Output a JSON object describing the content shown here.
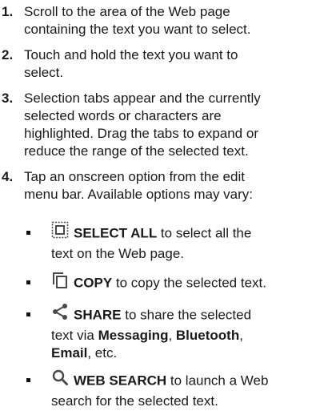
{
  "steps": [
    {
      "num": "1.",
      "lines": [
        "Scroll to the area of the Web page",
        "containing the text you want to select."
      ]
    },
    {
      "num": "2.",
      "lines": [
        "Touch and hold the text you want to",
        "select."
      ]
    },
    {
      "num": "3.",
      "lines": [
        "Selection tabs appear and the currently",
        "selected words or characters are",
        "highlighted. Drag the tabs to expand or",
        "reduce the range of the selected text."
      ]
    },
    {
      "num": "4.",
      "lines": [
        "Tap an onscreen option from the edit",
        "menu bar. Available options may vary:"
      ]
    }
  ],
  "options": [
    {
      "icon": "select-all-icon",
      "label": "SELECT ALL",
      "line1_rest": " to select all the",
      "line2": "text on the Web page."
    },
    {
      "icon": "copy-icon",
      "label": "COPY",
      "line1_rest": " to copy the selected text."
    },
    {
      "icon": "share-icon",
      "label": "SHARE",
      "line1_rest": " to share the selected",
      "line2_a": "text via ",
      "line2_b": "Messaging",
      "line2_c": ", ",
      "line2_d": "Bluetooth",
      "line2_e": ",",
      "line3_a": "Email",
      "line3_b": ", etc."
    },
    {
      "icon": "search-icon",
      "label": "WEB SEARCH",
      "line1_rest": " to launch a Web",
      "line2": "search for the selected text."
    }
  ],
  "colors": {
    "icon_gray": "#4a4a4a",
    "text": "#1a1a1a"
  }
}
